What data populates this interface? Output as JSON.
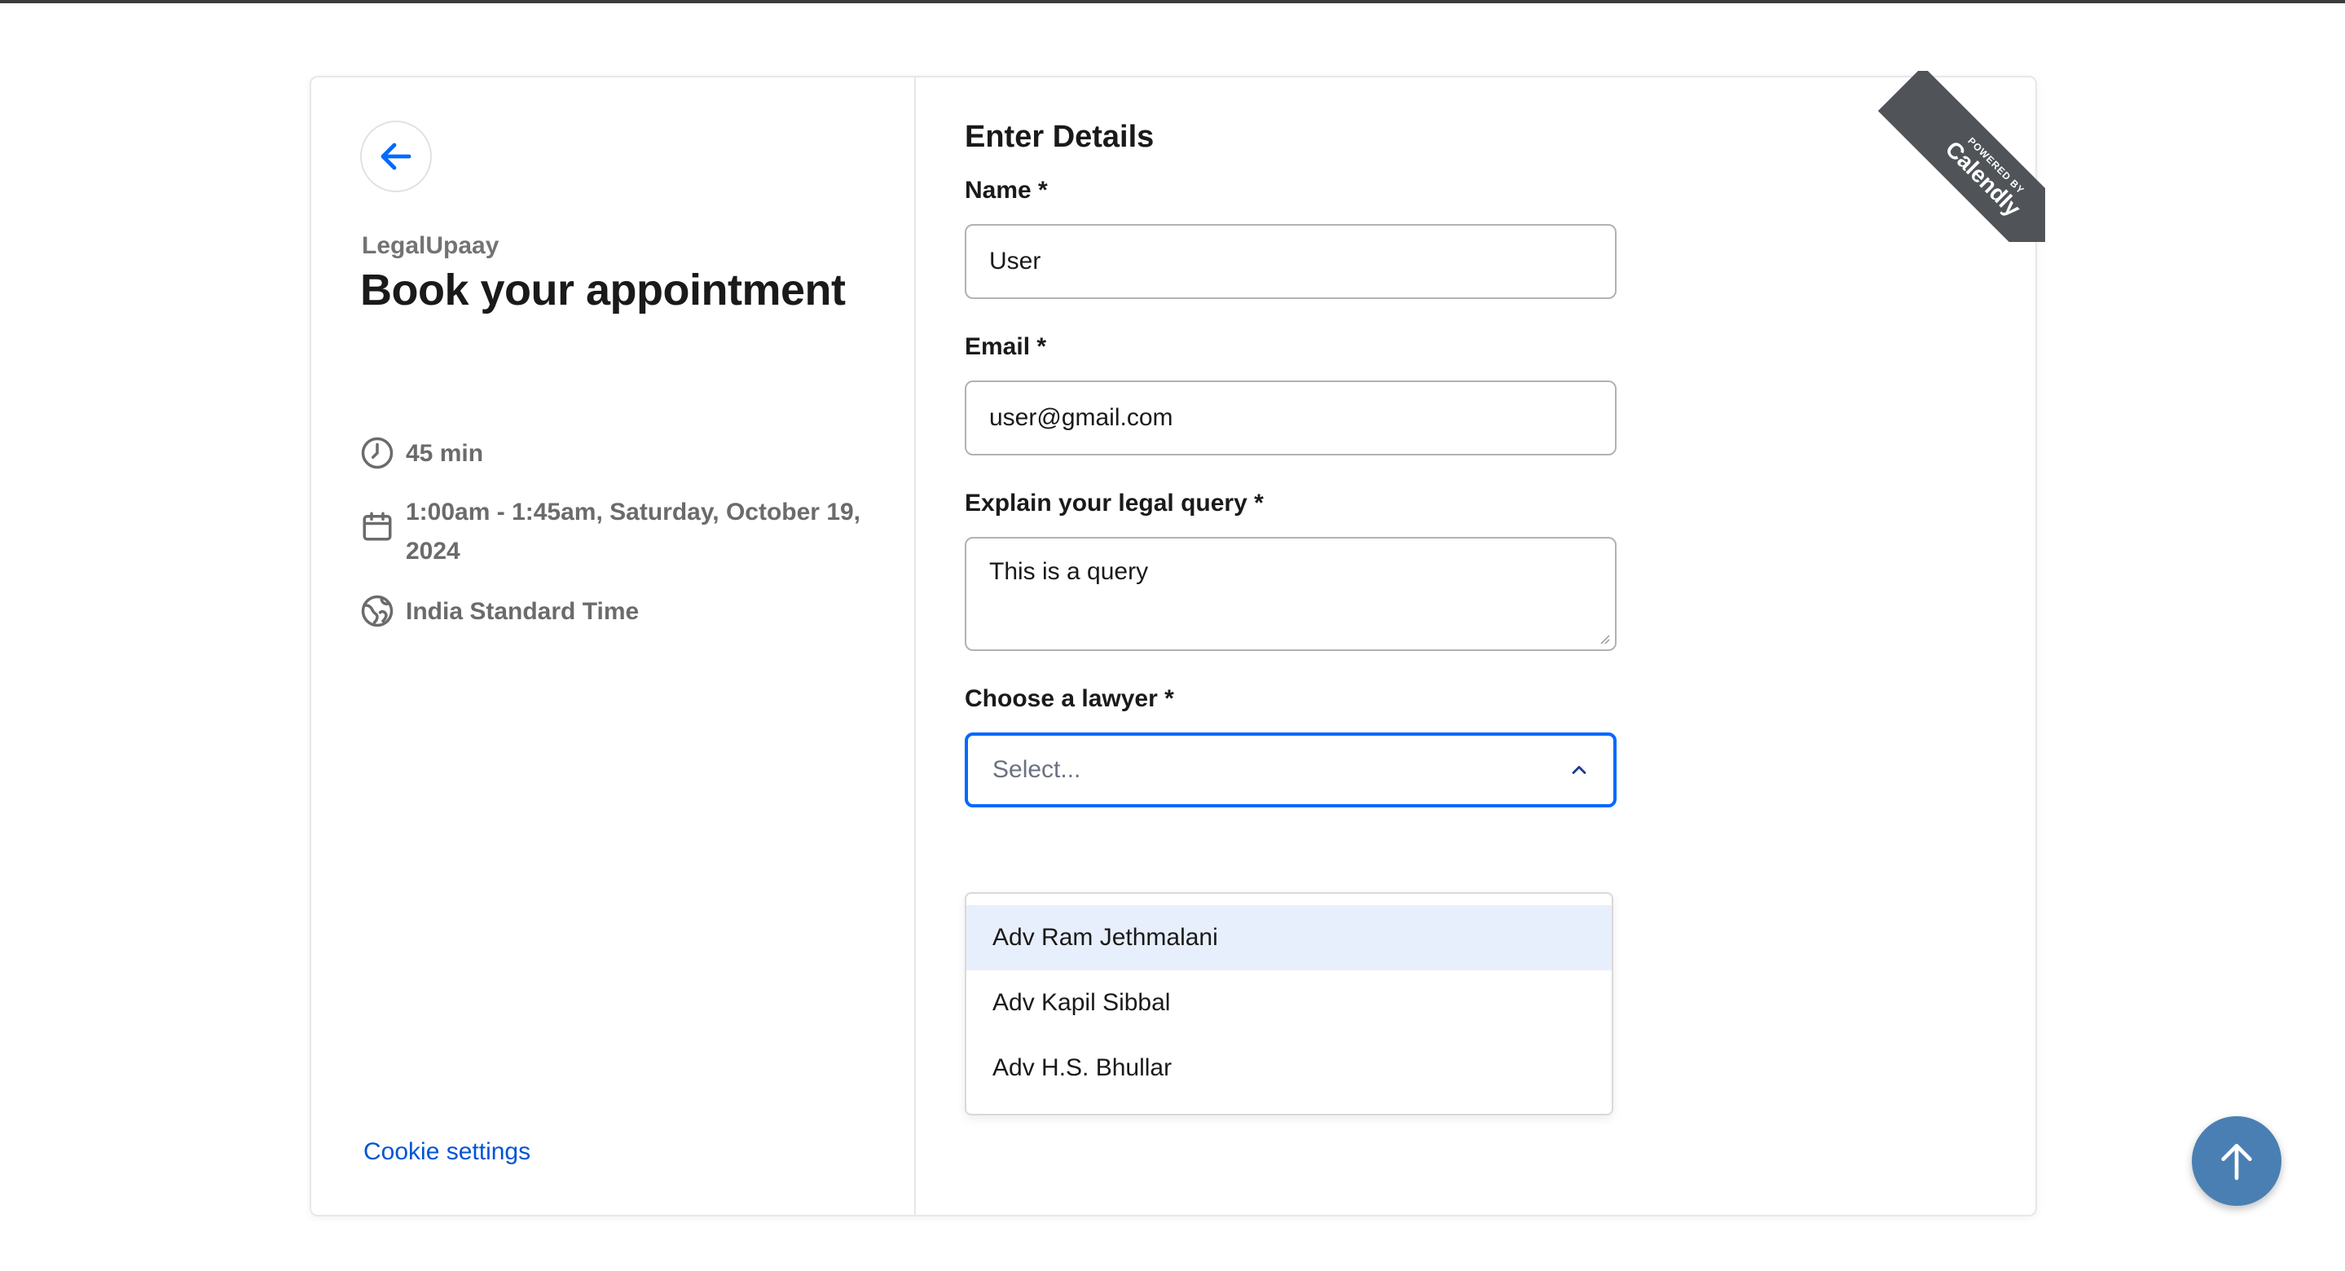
{
  "left": {
    "org_name": "LegalUpaay",
    "event_title": "Book your appointment",
    "duration": "45 min",
    "datetime": "1:00am - 1:45am, Saturday, October 19, 2024",
    "timezone": "India Standard Time",
    "cookie_link": "Cookie settings"
  },
  "form": {
    "title": "Enter Details",
    "name_label": "Name *",
    "name_value": "User",
    "email_label": "Email *",
    "email_value": "user@gmail.com",
    "query_label": "Explain your legal query *",
    "query_value": "This is a query",
    "lawyer_label": "Choose a lawyer *",
    "lawyer_placeholder": "Select...",
    "lawyer_options": [
      "Adv Ram Jethmalani",
      "Adv Kapil Sibbal",
      "Adv H.S. Bhullar"
    ]
  },
  "ribbon": {
    "small": "POWERED BY",
    "brand": "Calendly"
  },
  "colors": {
    "accent": "#0069ff",
    "link": "#0055d4",
    "ribbon": "#505458",
    "scroll_button": "#4a7fb3",
    "option_highlight": "#e8effc"
  },
  "icons": {
    "back": "arrow-left-icon",
    "duration": "clock-icon",
    "date": "calendar-icon",
    "timezone": "globe-icon",
    "select": "chevron-up-icon",
    "scroll": "arrow-up-icon"
  }
}
